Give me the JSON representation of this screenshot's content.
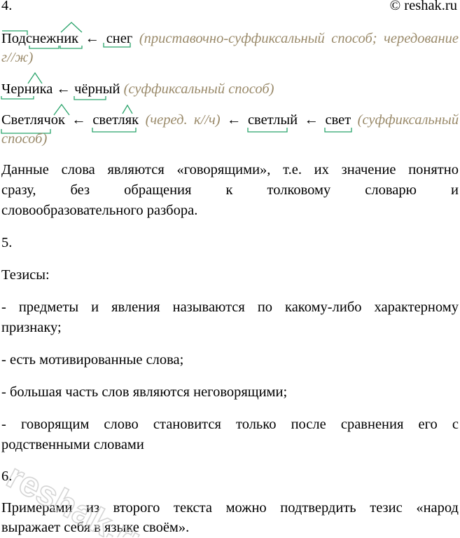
{
  "header": {
    "task_number": "4.",
    "source": "© reshak.ru"
  },
  "words": [
    {
      "left": "Подснежник",
      "arrow": "←",
      "right": "снег",
      "note_a": "(приставочно-суффиксальный способ; чередование",
      "note_b": "г//ж)"
    },
    {
      "left": "Черника",
      "arrow": "←",
      "right": "чёрный",
      "note": "(суффиксальный способ)"
    },
    {
      "w1": "Светлячок",
      "arrow1": "←",
      "w2": "светляк",
      "note1": "(черед. к//ч)",
      "arrow2": "←",
      "w3": "светлый",
      "arrow3": "←",
      "w4": "свет",
      "note_a": "(суффиксальный",
      "note_b": "способ)"
    }
  ],
  "para1": [
    "Данные слова являются «говорящими», т.е. их значение понятно",
    "сразу, без обращения к толковому словарю и",
    "словообразовательного разбора."
  ],
  "section5": {
    "number": "5.",
    "heading": "Тезисы:",
    "thesis1": [
      "- предметы и явления называются по какому-либо характерному",
      "признаку;"
    ],
    "thesis2": "- есть мотивированные слова;",
    "thesis3": "- большая часть слов являются неговорящими;",
    "thesis4": [
      "- говорящим слово становится только после сравнения его с",
      "родственными словами"
    ]
  },
  "section6": {
    "number": "6.",
    "text": [
      "Примерами из второго текста можно подтвердить тезис «народ",
      "выражает себя в языке своём»."
    ]
  },
  "watermark": {
    "text": "reshak.ru",
    "color": "#c8c8c8"
  },
  "colors": {
    "morpheme_marks": "#29a36a",
    "notes": "#9a8a6a"
  }
}
